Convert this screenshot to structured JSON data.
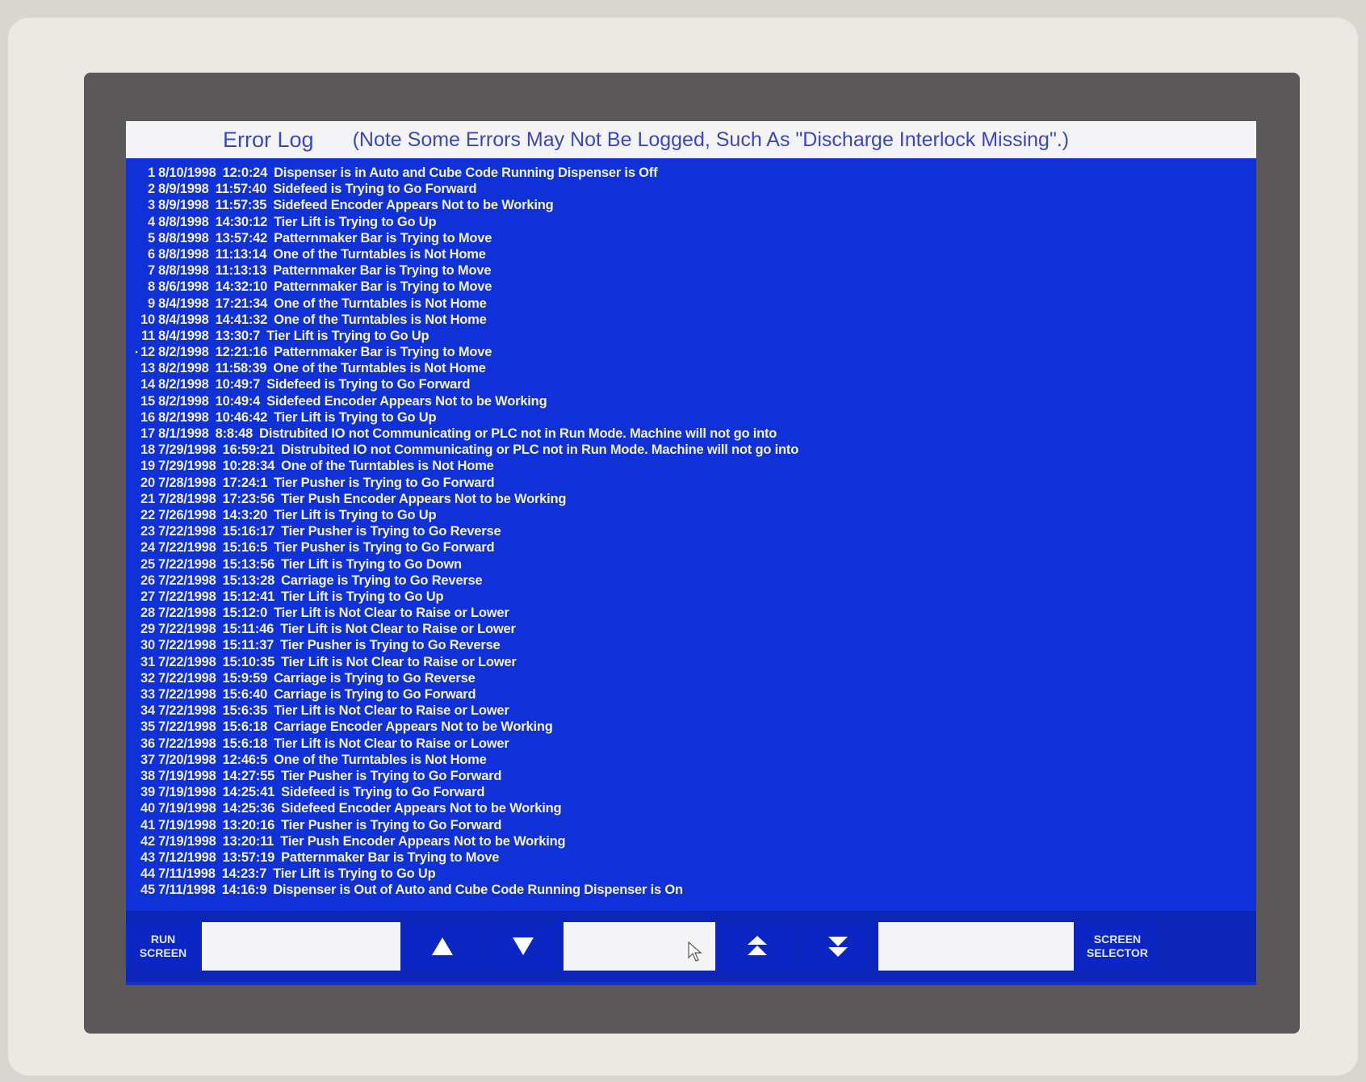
{
  "header": {
    "title": "Error Log",
    "note": "(Note Some Errors May Not Be Logged, Such As \"Discharge Interlock Missing\".)"
  },
  "log": {
    "selected_index": 12,
    "rows": [
      {
        "num": "1",
        "date": "8/10/1998",
        "time": "12:0:24",
        "msg": "Dispenser is in Auto and Cube Code Running Dispenser is Off"
      },
      {
        "num": "2",
        "date": "8/9/1998",
        "time": "11:57:40",
        "msg": "Sidefeed is Trying to Go Forward"
      },
      {
        "num": "3",
        "date": "8/9/1998",
        "time": "11:57:35",
        "msg": "Sidefeed Encoder Appears Not to be Working"
      },
      {
        "num": "4",
        "date": "8/8/1998",
        "time": "14:30:12",
        "msg": "Tier Lift is Trying to Go Up"
      },
      {
        "num": "5",
        "date": "8/8/1998",
        "time": "13:57:42",
        "msg": "Patternmaker Bar is Trying to Move"
      },
      {
        "num": "6",
        "date": "8/8/1998",
        "time": "11:13:14",
        "msg": "One of the Turntables is Not Home"
      },
      {
        "num": "7",
        "date": "8/8/1998",
        "time": "11:13:13",
        "msg": "Patternmaker Bar is Trying to Move"
      },
      {
        "num": "8",
        "date": "8/6/1998",
        "time": "14:32:10",
        "msg": "Patternmaker Bar is Trying to Move"
      },
      {
        "num": "9",
        "date": "8/4/1998",
        "time": "17:21:34",
        "msg": "One of the Turntables is Not Home"
      },
      {
        "num": "10",
        "date": "8/4/1998",
        "time": "14:41:32",
        "msg": "One of the Turntables is Not Home"
      },
      {
        "num": "11",
        "date": "8/4/1998",
        "time": "13:30:7",
        "msg": "Tier Lift is Trying to Go Up"
      },
      {
        "num": "12",
        "date": "8/2/1998",
        "time": "12:21:16",
        "msg": "Patternmaker Bar is Trying to Move"
      },
      {
        "num": "13",
        "date": "8/2/1998",
        "time": "11:58:39",
        "msg": "One of the Turntables is Not Home"
      },
      {
        "num": "14",
        "date": "8/2/1998",
        "time": "10:49:7",
        "msg": "Sidefeed is Trying to Go Forward"
      },
      {
        "num": "15",
        "date": "8/2/1998",
        "time": "10:49:4",
        "msg": "Sidefeed Encoder Appears Not to be Working"
      },
      {
        "num": "16",
        "date": "8/2/1998",
        "time": "10:46:42",
        "msg": "Tier Lift is Trying to Go Up"
      },
      {
        "num": "17",
        "date": "8/1/1998",
        "time": "8:8:48",
        "msg": "Distrubited IO not Communicating or PLC not in Run Mode. Machine will not go into"
      },
      {
        "num": "18",
        "date": "7/29/1998",
        "time": "16:59:21",
        "msg": "Distrubited IO not Communicating or PLC not in Run Mode. Machine will not go into"
      },
      {
        "num": "19",
        "date": "7/29/1998",
        "time": "10:28:34",
        "msg": "One of the Turntables is Not Home"
      },
      {
        "num": "20",
        "date": "7/28/1998",
        "time": "17:24:1",
        "msg": "Tier Pusher is Trying to Go Forward"
      },
      {
        "num": "21",
        "date": "7/28/1998",
        "time": "17:23:56",
        "msg": "Tier Push Encoder Appears Not to be Working"
      },
      {
        "num": "22",
        "date": "7/26/1998",
        "time": "14:3:20",
        "msg": "Tier Lift is Trying to Go Up"
      },
      {
        "num": "23",
        "date": "7/22/1998",
        "time": "15:16:17",
        "msg": "Tier Pusher is Trying to Go Reverse"
      },
      {
        "num": "24",
        "date": "7/22/1998",
        "time": "15:16:5",
        "msg": "Tier Pusher is Trying to Go Forward"
      },
      {
        "num": "25",
        "date": "7/22/1998",
        "time": "15:13:56",
        "msg": "Tier Lift is Trying to Go Down"
      },
      {
        "num": "26",
        "date": "7/22/1998",
        "time": "15:13:28",
        "msg": "Carriage is Trying to Go Reverse"
      },
      {
        "num": "27",
        "date": "7/22/1998",
        "time": "15:12:41",
        "msg": "Tier Lift is Trying to Go Up"
      },
      {
        "num": "28",
        "date": "7/22/1998",
        "time": "15:12:0",
        "msg": "Tier Lift is Not Clear to Raise or Lower"
      },
      {
        "num": "29",
        "date": "7/22/1998",
        "time": "15:11:46",
        "msg": "Tier Lift is Not Clear to Raise or Lower"
      },
      {
        "num": "30",
        "date": "7/22/1998",
        "time": "15:11:37",
        "msg": "Tier Pusher is Trying to Go Reverse"
      },
      {
        "num": "31",
        "date": "7/22/1998",
        "time": "15:10:35",
        "msg": "Tier Lift is Not Clear to Raise or Lower"
      },
      {
        "num": "32",
        "date": "7/22/1998",
        "time": "15:9:59",
        "msg": "Carriage is Trying to Go Reverse"
      },
      {
        "num": "33",
        "date": "7/22/1998",
        "time": "15:6:40",
        "msg": "Carriage is Trying to Go Forward"
      },
      {
        "num": "34",
        "date": "7/22/1998",
        "time": "15:6:35",
        "msg": "Tier Lift is Not Clear to Raise or Lower"
      },
      {
        "num": "35",
        "date": "7/22/1998",
        "time": "15:6:18",
        "msg": "Carriage Encoder Appears Not to be Working"
      },
      {
        "num": "36",
        "date": "7/22/1998",
        "time": "15:6:18",
        "msg": "Tier Lift is Not Clear to Raise or Lower"
      },
      {
        "num": "37",
        "date": "7/20/1998",
        "time": "12:46:5",
        "msg": "One of the Turntables is Not Home"
      },
      {
        "num": "38",
        "date": "7/19/1998",
        "time": "14:27:55",
        "msg": "Tier Pusher is Trying to Go Forward"
      },
      {
        "num": "39",
        "date": "7/19/1998",
        "time": "14:25:41",
        "msg": "Sidefeed is Trying to Go Forward"
      },
      {
        "num": "40",
        "date": "7/19/1998",
        "time": "14:25:36",
        "msg": "Sidefeed Encoder Appears Not to be Working"
      },
      {
        "num": "41",
        "date": "7/19/1998",
        "time": "13:20:16",
        "msg": "Tier Pusher is Trying to Go Forward"
      },
      {
        "num": "42",
        "date": "7/19/1998",
        "time": "13:20:11",
        "msg": "Tier Push Encoder Appears Not to be Working"
      },
      {
        "num": "43",
        "date": "7/12/1998",
        "time": "13:57:19",
        "msg": "Patternmaker Bar is Trying to Move"
      },
      {
        "num": "44",
        "date": "7/11/1998",
        "time": "14:23:7",
        "msg": "Tier Lift is Trying to Go Up"
      },
      {
        "num": "45",
        "date": "7/11/1998",
        "time": "14:16:9",
        "msg": "Dispenser is Out of Auto and Cube Code Running Dispenser is On"
      }
    ]
  },
  "buttons": {
    "run_screen": "RUN SCREEN",
    "screen_selector": "SCREEN SELECTOR",
    "up_icon": "arrow-up-icon",
    "down_icon": "arrow-down-icon",
    "page_up_icon": "double-arrow-up-icon",
    "page_down_icon": "double-arrow-down-icon"
  },
  "colors": {
    "screen_bg": "#1030d8",
    "log_text": "#f2f2c8",
    "title_text": "#3a48b8"
  }
}
